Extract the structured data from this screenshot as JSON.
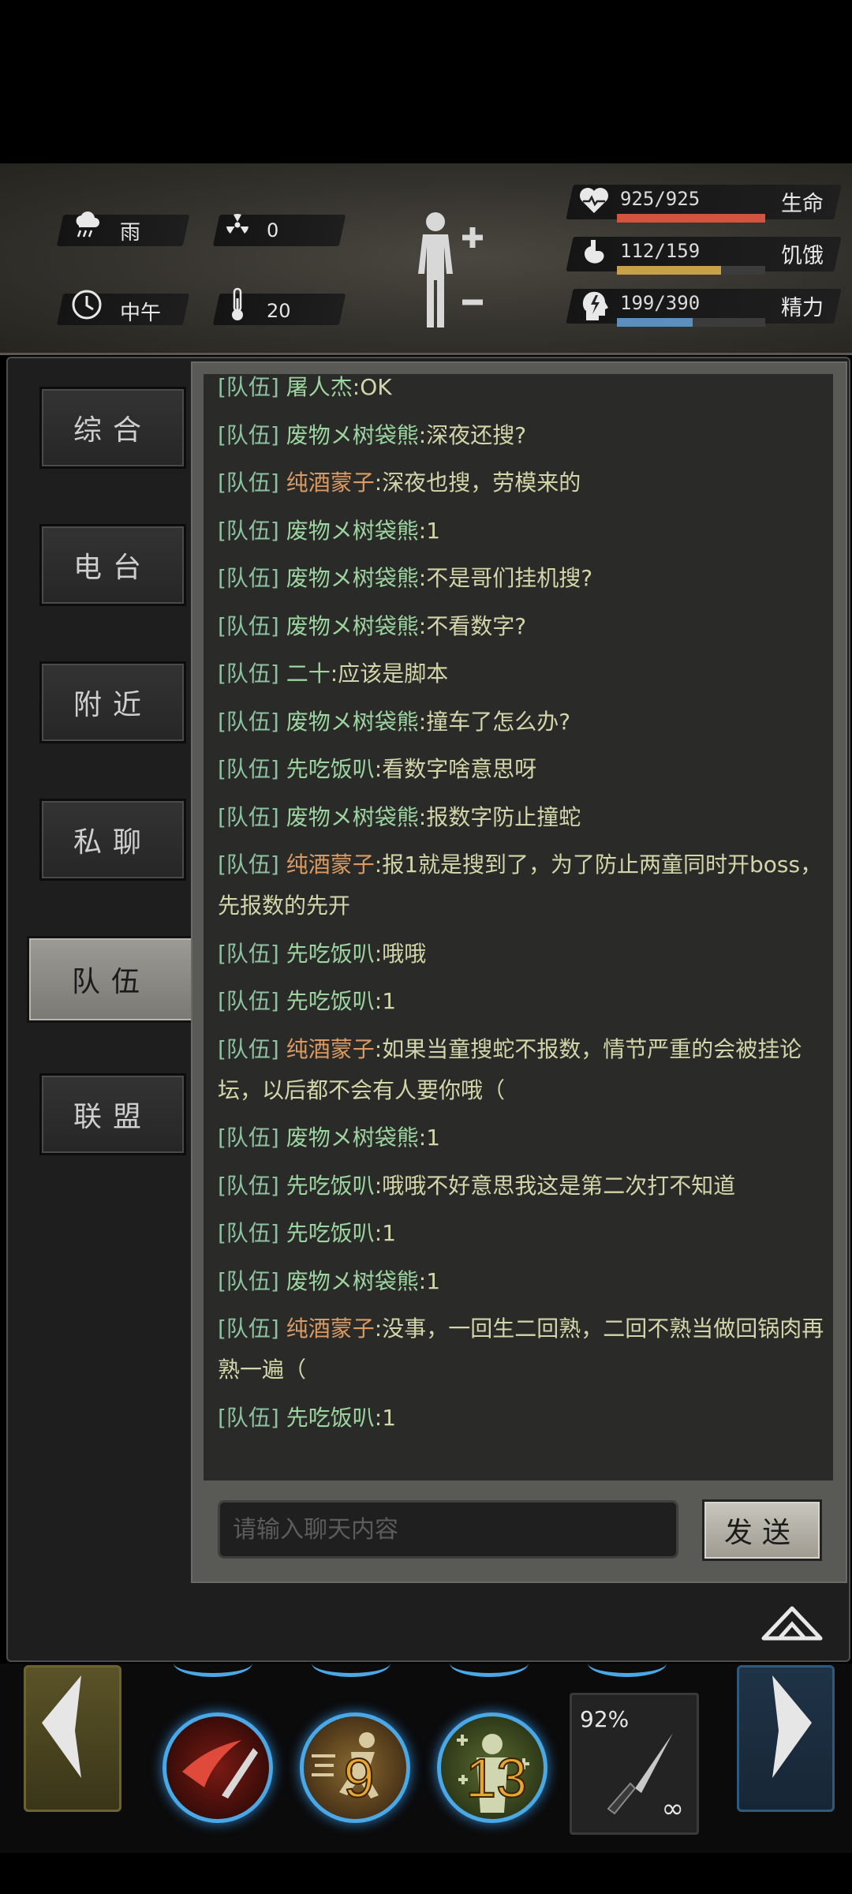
{
  "status": {
    "weather": {
      "icon": "rain-cloud-icon",
      "label": "雨"
    },
    "radiation": {
      "icon": "radiation-icon",
      "value": "0"
    },
    "time": {
      "icon": "clock-icon",
      "label": "中午"
    },
    "temperature": {
      "icon": "thermometer-icon",
      "value": "20"
    },
    "stats": [
      {
        "name": "health",
        "icon": "heart-icon",
        "value": "925/925",
        "label": "生命",
        "fill": 1.0,
        "color": "#d4533e"
      },
      {
        "name": "hunger",
        "icon": "stomach-icon",
        "value": "112/159",
        "label": "饥饿",
        "fill": 0.704,
        "color": "#c9a04a"
      },
      {
        "name": "energy",
        "icon": "lightning-head-icon",
        "value": "199/390",
        "label": "精力",
        "fill": 0.51,
        "color": "#5b8fbf"
      }
    ]
  },
  "tabs": [
    {
      "id": "general",
      "label": "综合",
      "active": false
    },
    {
      "id": "radio",
      "label": "电台",
      "active": false
    },
    {
      "id": "nearby",
      "label": "附近",
      "active": false
    },
    {
      "id": "private",
      "label": "私聊",
      "active": false
    },
    {
      "id": "team",
      "label": "队伍",
      "active": true
    },
    {
      "id": "alliance",
      "label": "联盟",
      "active": false
    }
  ],
  "messages": [
    {
      "channel": "[队伍]",
      "name": "屠人杰",
      "name_color": "green",
      "text": ":OK"
    },
    {
      "channel": "[队伍]",
      "name": "废物メ树袋熊",
      "name_color": "green",
      "text": ":深夜还搜?"
    },
    {
      "channel": "[队伍]",
      "name": "纯酒蒙子",
      "name_color": "orange",
      "text": ":深夜也搜，劳模来的"
    },
    {
      "channel": "[队伍]",
      "name": "废物メ树袋熊",
      "name_color": "green",
      "text": ":1"
    },
    {
      "channel": "[队伍]",
      "name": "废物メ树袋熊",
      "name_color": "green",
      "text": ":不是哥们挂机搜?"
    },
    {
      "channel": "[队伍]",
      "name": "废物メ树袋熊",
      "name_color": "green",
      "text": ":不看数字?"
    },
    {
      "channel": "[队伍]",
      "name": "二十",
      "name_color": "green",
      "text": ":应该是脚本"
    },
    {
      "channel": "[队伍]",
      "name": "废物メ树袋熊",
      "name_color": "green",
      "text": ":撞车了怎么办?"
    },
    {
      "channel": "[队伍]",
      "name": "先吃饭叭",
      "name_color": "green",
      "text": ":看数字啥意思呀"
    },
    {
      "channel": "[队伍]",
      "name": "废物メ树袋熊",
      "name_color": "green",
      "text": ":报数字防止撞蛇"
    },
    {
      "channel": "[队伍]",
      "name": "纯酒蒙子",
      "name_color": "orange",
      "text": ":报1就是搜到了，为了防止两童同时开boss，先报数的先开"
    },
    {
      "channel": "[队伍]",
      "name": "先吃饭叭",
      "name_color": "green",
      "text": ":哦哦"
    },
    {
      "channel": "[队伍]",
      "name": "先吃饭叭",
      "name_color": "green",
      "text": ":1"
    },
    {
      "channel": "[队伍]",
      "name": "纯酒蒙子",
      "name_color": "orange",
      "text": ":如果当童搜蛇不报数，情节严重的会被挂论坛，以后都不会有人要你哦（"
    },
    {
      "channel": "[队伍]",
      "name": "废物メ树袋熊",
      "name_color": "green",
      "text": ":1"
    },
    {
      "channel": "[队伍]",
      "name": "先吃饭叭",
      "name_color": "green",
      "text": ":哦哦不好意思我这是第二次打不知道"
    },
    {
      "channel": "[队伍]",
      "name": "先吃饭叭",
      "name_color": "green",
      "text": ":1"
    },
    {
      "channel": "[队伍]",
      "name": "废物メ树袋熊",
      "name_color": "green",
      "text": ":1"
    },
    {
      "channel": "[队伍]",
      "name": "纯酒蒙子",
      "name_color": "orange",
      "text": ":没事，一回生二回熟，二回不熟当做回锅肉再熟一遍（"
    },
    {
      "channel": "[队伍]",
      "name": "先吃饭叭",
      "name_color": "green",
      "text": ":1"
    }
  ],
  "input": {
    "placeholder": "请输入聊天内容"
  },
  "send_label": "发送",
  "skills": [
    {
      "name": "slash-skill",
      "icon": "slash-attack-icon",
      "count": ""
    },
    {
      "name": "sprint-skill",
      "icon": "running-man-icon",
      "count": "9"
    },
    {
      "name": "heal-skill",
      "icon": "healing-body-icon",
      "count": "13"
    }
  ],
  "weapon": {
    "icon": "knife-icon",
    "durability": "92%",
    "ammo": "∞"
  },
  "colors": {
    "accent_blue": "#4aa8e6",
    "name_orange": "#d99b63",
    "name_green": "#9cd5a0"
  }
}
